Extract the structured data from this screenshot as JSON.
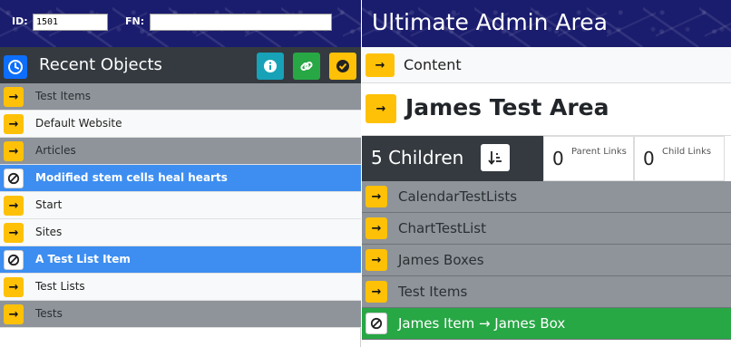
{
  "left": {
    "id_label": "ID:",
    "id_value": "1501",
    "fn_label": "FN:",
    "fn_value": "",
    "recent_title": "Recent Objects",
    "header_buttons": [
      {
        "icon": "info-icon",
        "color": "#17a2b8"
      },
      {
        "icon": "link-icon",
        "color": "#28a745"
      },
      {
        "icon": "check-circle-icon",
        "color": "#ffc107"
      }
    ],
    "recent_items": [
      {
        "label": "Test Items",
        "style": "gray",
        "icon": "arrow-right-icon"
      },
      {
        "label": "Default Website",
        "style": "white",
        "icon": "arrow-right-icon"
      },
      {
        "label": "Articles",
        "style": "gray",
        "icon": "arrow-right-icon"
      },
      {
        "label": "Modified stem cells heal hearts",
        "style": "blue",
        "icon": "ban-icon"
      },
      {
        "label": "Start",
        "style": "white",
        "icon": "arrow-right-icon"
      },
      {
        "label": "Sites",
        "style": "white",
        "icon": "arrow-right-icon"
      },
      {
        "label": "A Test List Item",
        "style": "blue",
        "icon": "ban-icon"
      },
      {
        "label": "Test Lists",
        "style": "white",
        "icon": "arrow-right-icon"
      },
      {
        "label": "Tests",
        "style": "gray",
        "icon": "arrow-right-icon"
      }
    ]
  },
  "right": {
    "title": "Ultimate Admin Area",
    "crumb_label": "Content",
    "area_title": "James Test Area",
    "children_label": "5 Children",
    "parent_links": {
      "count": "0",
      "label": "Parent Links"
    },
    "child_links": {
      "count": "0",
      "label": "Child Links"
    },
    "children": [
      {
        "label": "CalendarTestLists",
        "style": "gray",
        "icon": "arrow-right-icon"
      },
      {
        "label": "ChartTestList",
        "style": "gray",
        "icon": "arrow-right-icon"
      },
      {
        "label": "James Boxes",
        "style": "gray",
        "icon": "arrow-right-icon"
      },
      {
        "label": "Test Items",
        "style": "gray",
        "icon": "arrow-right-icon"
      },
      {
        "label": "James Item → James Box",
        "style": "green",
        "icon": "ban-icon"
      }
    ]
  },
  "colors": {
    "header_navy": "#1a1c6e",
    "dark": "#343a40",
    "row_gray": "#8e949a",
    "highlight_blue": "#3d8ef0",
    "warning_yellow": "#ffc107",
    "success_green": "#28a745",
    "info_teal": "#17a2b8",
    "primary_blue": "#0d6efd"
  }
}
